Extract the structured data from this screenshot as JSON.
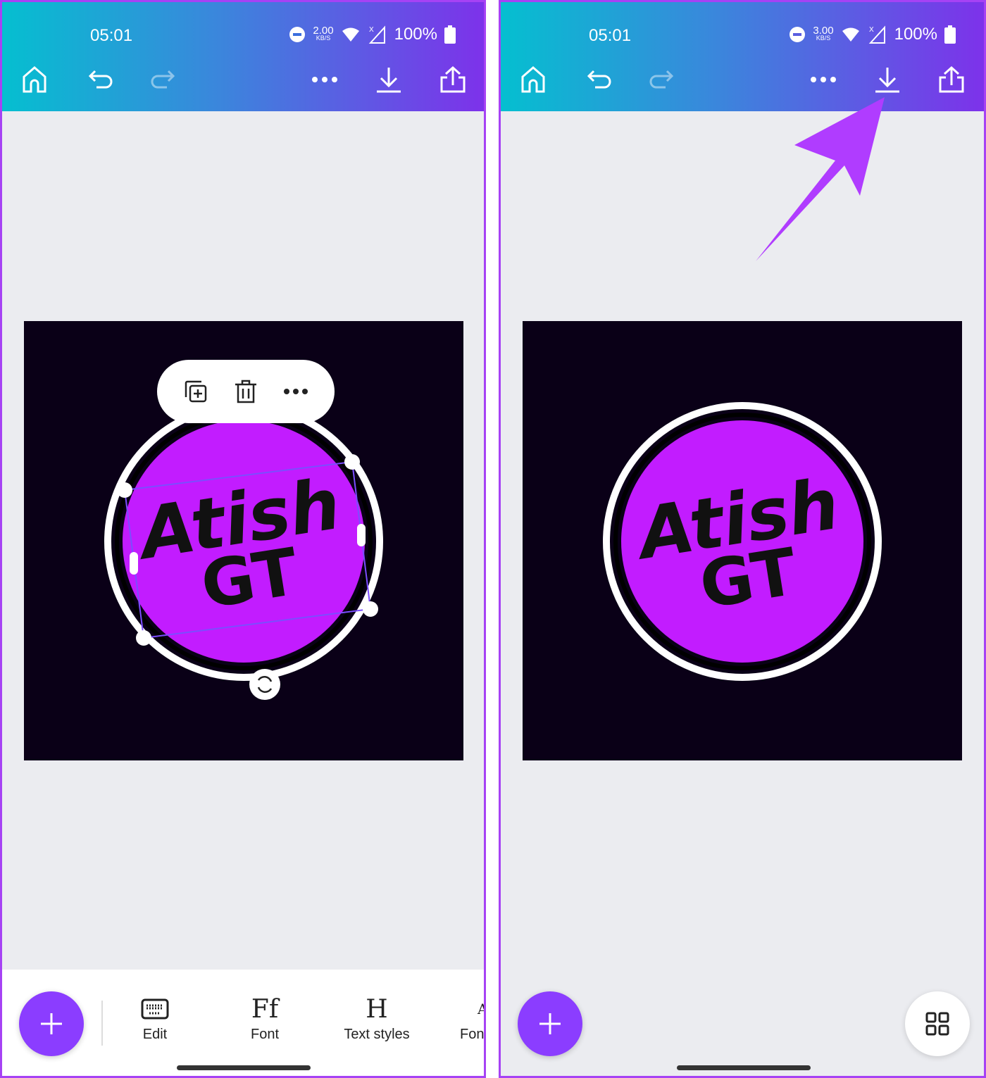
{
  "left": {
    "status": {
      "time": "05:01",
      "speed": "2.00",
      "speed_unit": "KB/S",
      "battery": "100%"
    },
    "toolbar": [
      "home-icon",
      "undo-icon",
      "redo-icon",
      "more-icon",
      "download-icon",
      "share-icon"
    ],
    "design": {
      "line1": "Atish",
      "line2": "GT",
      "fill": "#c21cff",
      "bg": "#0a0017"
    },
    "context_menu": [
      "duplicate-icon",
      "delete-icon",
      "more-icon"
    ],
    "bottom_tools": [
      {
        "label": "Edit",
        "icon": "keyboard-icon"
      },
      {
        "label": "Font",
        "icon": "Ff"
      },
      {
        "label": "Text styles",
        "icon": "H"
      },
      {
        "label": "Font",
        "icon": "A"
      }
    ]
  },
  "right": {
    "status": {
      "time": "05:01",
      "speed": "3.00",
      "speed_unit": "KB/S",
      "battery": "100%"
    },
    "design": {
      "line1": "Atish",
      "line2": "GT"
    },
    "annotation": "arrow pointing to download button",
    "arrow_color": "#b03cff"
  }
}
